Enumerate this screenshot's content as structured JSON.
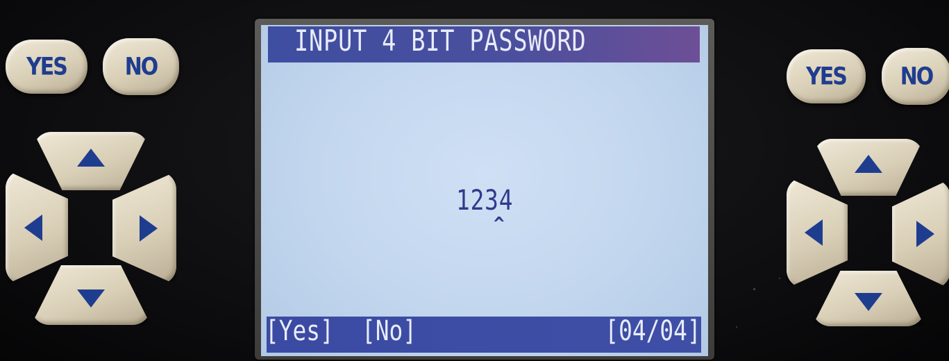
{
  "left_keypad": {
    "yes_label": "YES",
    "no_label": "NO"
  },
  "right_keypad": {
    "yes_label": "YES",
    "no_label": "NO"
  },
  "screen": {
    "title": "INPUT 4 BIT PASSWORD",
    "password_value": "1234",
    "cursor_glyph": "^",
    "footer": {
      "yes_option": "[Yes]",
      "no_option": "[No]",
      "page_indicator": "[04/04]"
    }
  },
  "colors": {
    "lcd_background": "#c6d9f0",
    "lcd_bar": "#3e4ea0",
    "key_label": "#1f3d8f",
    "key_body": "#ddd3bc"
  },
  "icons": {
    "up": "arrow-up-icon",
    "down": "arrow-down-icon",
    "left": "arrow-left-icon",
    "right": "arrow-right-icon"
  }
}
